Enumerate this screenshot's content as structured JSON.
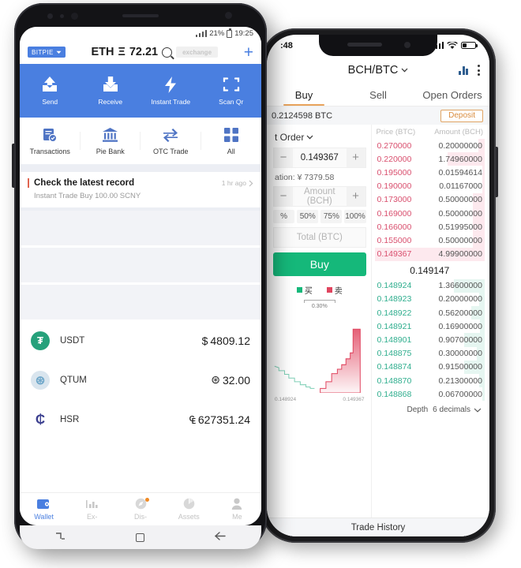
{
  "android_phone": {
    "status_bar": {
      "signal": "signal-icon",
      "battery_pct": "21%",
      "time": "19:25"
    },
    "header": {
      "brand_badge": "BITPIE",
      "title": "ETH",
      "symbol": "Ξ",
      "price": "72.21",
      "search_icon": "search-icon",
      "search_placeholder": "exchange",
      "add_label": "+"
    },
    "primary_actions": [
      {
        "label": "Send",
        "icon": "send-icon"
      },
      {
        "label": "Receive",
        "icon": "receive-icon"
      },
      {
        "label": "Instant Trade",
        "icon": "lightning-icon"
      },
      {
        "label": "Scan Qr",
        "icon": "scan-qr-icon"
      }
    ],
    "secondary_actions": [
      {
        "label": "Transactions",
        "icon": "receipt-check-icon"
      },
      {
        "label": "Pie Bank",
        "icon": "bank-icon"
      },
      {
        "label": "OTC Trade",
        "icon": "exchange-arrows-icon"
      },
      {
        "label": "All",
        "icon": "grid-icon"
      }
    ],
    "record_card": {
      "title": "Check the latest record",
      "time_ago": "1 hr ago",
      "chevron": "chevron-right-icon",
      "subtitle": "Instant Trade Buy 100.00 SCNY"
    },
    "placeholder_rows": 3,
    "assets": [
      {
        "name": "USDT",
        "symbol": "$",
        "amount": "4809.12",
        "icon": "usdt-icon",
        "color": "#26a17b"
      },
      {
        "name": "QTUM",
        "symbol": "⊛",
        "amount": "32.00",
        "icon": "qtum-icon",
        "color": "#6fa7c9"
      },
      {
        "name": "HSR",
        "symbol": "₠",
        "amount": "627351.24",
        "icon": "hsr-icon",
        "color": "#3b3f8f"
      }
    ],
    "bottom_nav": [
      {
        "label": "Wallet",
        "icon": "wallet-icon",
        "active": true,
        "badge": false
      },
      {
        "label": "Ex-",
        "icon": "chart-bars-icon",
        "active": false,
        "badge": false
      },
      {
        "label": "Dis-",
        "icon": "compass-icon",
        "active": false,
        "badge": true
      },
      {
        "label": "Assets",
        "icon": "pie-chart-icon",
        "active": false,
        "badge": false
      },
      {
        "label": "Me",
        "icon": "person-icon",
        "active": false,
        "badge": false
      }
    ],
    "soft_keys": [
      {
        "name": "recents-key",
        "glyph": "⊐⌐"
      },
      {
        "name": "home-key",
        "glyph": "□"
      },
      {
        "name": "back-key",
        "glyph": "←"
      }
    ]
  },
  "iphone": {
    "status_bar": {
      "time": ":48",
      "signal": "signal-icon",
      "wifi": "wifi-icon",
      "battery": "battery-icon"
    },
    "navbar": {
      "pair": "BCH/BTC",
      "chevron": "chevron-down-icon",
      "chart_icon": "chart-bars-icon",
      "menu_icon": "more-vertical-icon"
    },
    "tabs": [
      {
        "label": "Buy",
        "active": true
      },
      {
        "label": "Sell",
        "active": false
      },
      {
        "label": "Open Orders",
        "active": false
      }
    ],
    "balance_row": {
      "balance": "0.2124598 BTC",
      "deposit_label": "Deposit"
    },
    "order_form": {
      "order_type": "t Order",
      "price_value": "0.149367",
      "minus": "−",
      "plus": "+",
      "valuation": "ation: ¥ 7379.58",
      "amount_placeholder": "Amount (BCH)",
      "percents": [
        "%",
        "50%",
        "75%",
        "100%"
      ],
      "total_placeholder": "Total (BTC)",
      "submit_label": "Buy"
    },
    "depth_chart": {
      "legend_buy": "买",
      "legend_sell": "卖",
      "spread": "0.30%",
      "x_left": "0.148924",
      "x_right": "0.149367"
    },
    "order_book": {
      "col_price": "Price (BTC)",
      "col_amount": "Amount (BCH)",
      "asks": [
        {
          "price": "0.270000",
          "amount": "0.20000000",
          "depth": 6
        },
        {
          "price": "0.220000",
          "amount": "1.74960000",
          "depth": 34
        },
        {
          "price": "0.195000",
          "amount": "0.01594614",
          "depth": 2
        },
        {
          "price": "0.190000",
          "amount": "0.01167000",
          "depth": 2
        },
        {
          "price": "0.173000",
          "amount": "0.50000000",
          "depth": 11
        },
        {
          "price": "0.169000",
          "amount": "0.50000000",
          "depth": 11
        },
        {
          "price": "0.166000",
          "amount": "0.51995000",
          "depth": 11
        },
        {
          "price": "0.155000",
          "amount": "0.50000000",
          "depth": 11
        },
        {
          "price": "0.149367",
          "amount": "4.99900000",
          "depth": 100
        }
      ],
      "last_price": "0.149147",
      "bids": [
        {
          "price": "0.148924",
          "amount": "1.36600000",
          "depth": 28
        },
        {
          "price": "0.148923",
          "amount": "0.20000000",
          "depth": 5
        },
        {
          "price": "0.148922",
          "amount": "0.56200000",
          "depth": 12
        },
        {
          "price": "0.148921",
          "amount": "0.16900000",
          "depth": 4
        },
        {
          "price": "0.148901",
          "amount": "0.90700000",
          "depth": 19
        },
        {
          "price": "0.148875",
          "amount": "0.30000000",
          "depth": 7
        },
        {
          "price": "0.148874",
          "amount": "0.91500000",
          "depth": 19
        },
        {
          "price": "0.148870",
          "amount": "0.21300000",
          "depth": 5
        },
        {
          "price": "0.148868",
          "amount": "0.06700000",
          "depth": 2
        }
      ],
      "depth_label": "Depth",
      "depth_value": "6 decimals",
      "depth_chevron": "chevron-down-icon"
    },
    "trade_history_label": "Trade History"
  },
  "colors": {
    "android_accent": "#4a7fe0",
    "buy_green": "#15b87a",
    "ask_red": "#d94f6e",
    "bid_green": "#2fae8e",
    "deposit_orange": "#d98b3c",
    "tab_underline": "#e8a35c"
  }
}
